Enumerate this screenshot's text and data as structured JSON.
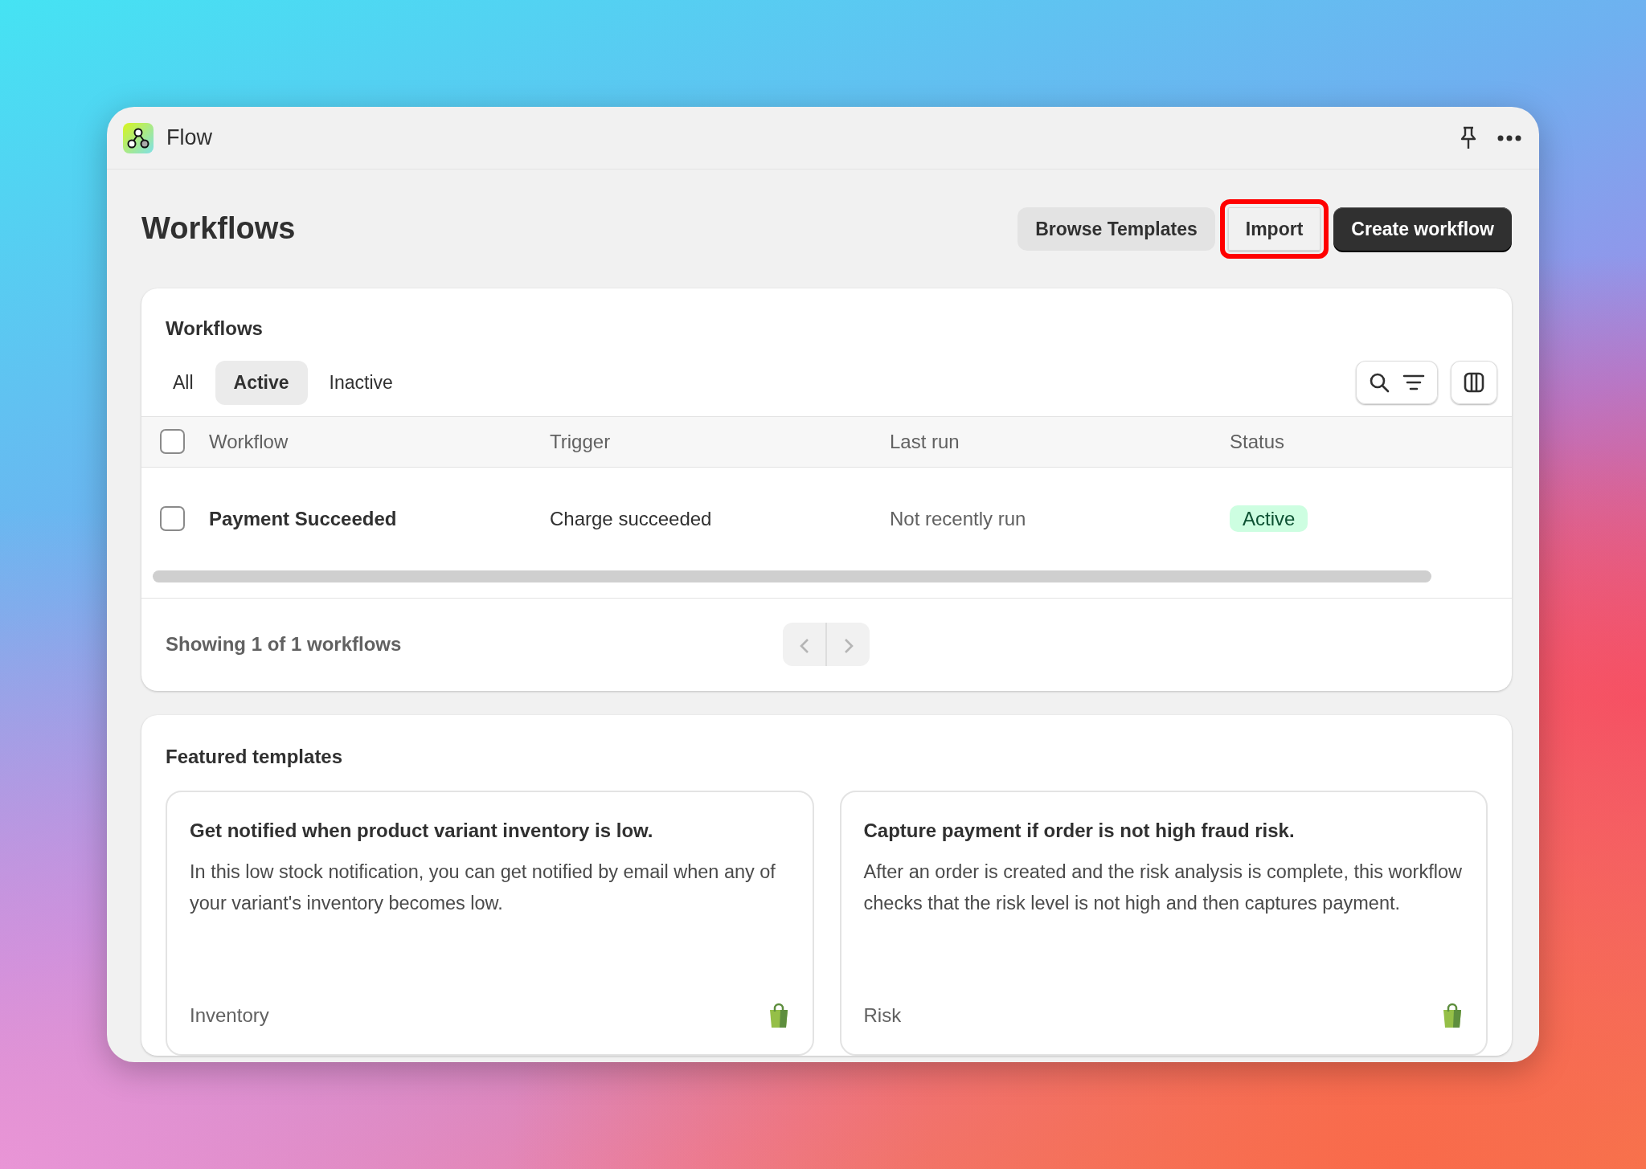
{
  "window": {
    "title": "Flow"
  },
  "page": {
    "title": "Workflows",
    "actions": [
      {
        "label": "Browse Templates",
        "kind": "secondary",
        "highlighted": false
      },
      {
        "label": "Import",
        "kind": "outline",
        "highlighted": true
      },
      {
        "label": "Create workflow",
        "kind": "primary",
        "highlighted": false
      }
    ]
  },
  "workflows_card": {
    "title": "Workflows",
    "tabs": [
      {
        "label": "All",
        "selected": false
      },
      {
        "label": "Active",
        "selected": true
      },
      {
        "label": "Inactive",
        "selected": false
      }
    ],
    "table": {
      "columns": [
        "Workflow",
        "Trigger",
        "Last run",
        "Status"
      ],
      "header_checked": false,
      "rows": [
        {
          "checked": false,
          "cells": [
            "Payment Succeeded",
            "Charge succeeded",
            "Not recently run"
          ],
          "status": "Active"
        }
      ]
    },
    "footer": "Showing 1 of 1 workflows",
    "pagination": {
      "previous_disabled": true,
      "next_disabled": true
    }
  },
  "featured": {
    "title": "Featured templates",
    "templates": [
      {
        "title": "Get notified when product variant inventory is low.",
        "description": "In this low stock notification, you can get notified by email when any of your variant's inventory becomes low.",
        "category": "Inventory"
      },
      {
        "title": "Capture payment if order is not high fraud risk.",
        "description": "After an order is created and the risk analysis is complete, this workflow checks that the risk level is not high and then captures payment.",
        "category": "Risk"
      }
    ]
  }
}
